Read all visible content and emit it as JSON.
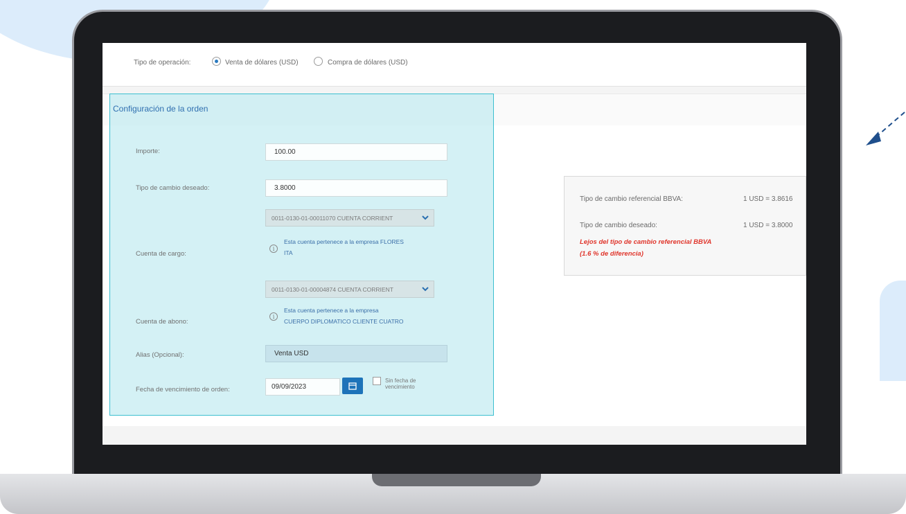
{
  "operation": {
    "label": "Tipo de operación:",
    "options": [
      {
        "label": "Venta de dólares (USD)",
        "selected": true
      },
      {
        "label": "Compra de dólares (USD)",
        "selected": false
      }
    ]
  },
  "config": {
    "title": "Configuración de la orden",
    "importe": {
      "label": "Importe:",
      "value": "100.00"
    },
    "tipo_cambio": {
      "label": "Tipo de cambio deseado:",
      "value": "3.8000"
    },
    "cuenta_cargo": {
      "label": "Cuenta de cargo:",
      "account": "0011-0130-01-00011070 CUENTA CORRIENT",
      "info_line1": "Esta cuenta pertenece a la empresa FLORES",
      "info_line2": "ITA"
    },
    "cuenta_abono": {
      "label": "Cuenta de abono:",
      "account": "0011-0130-01-00004874 CUENTA CORRIENT",
      "info_line1": "Esta cuenta pertenece a la empresa",
      "info_line2": "CUERPO DIPLOMATICO CLIENTE CUATRO"
    },
    "alias": {
      "label": "Alias (Opcional):",
      "value": "Venta USD"
    },
    "fecha": {
      "label": "Fecha de vencimiento de orden:",
      "value": "09/09/2023",
      "no_date_line1": "Sin fecha de",
      "no_date_line2": "vencimiento"
    }
  },
  "reference": {
    "ref_label": "Tipo de cambio referencial BBVA:",
    "ref_value": "1 USD = 3.8616",
    "desired_label": "Tipo de cambio deseado:",
    "desired_value": "1 USD = 3.8000",
    "warning_line1": "Lejos del tipo de cambio referencial BBVA",
    "warning_line2": "(1.6 % de diferencia)"
  },
  "colors": {
    "accent": "#1d73b9",
    "highlight_border": "#3bbfd0",
    "warning": "#e0362c"
  }
}
